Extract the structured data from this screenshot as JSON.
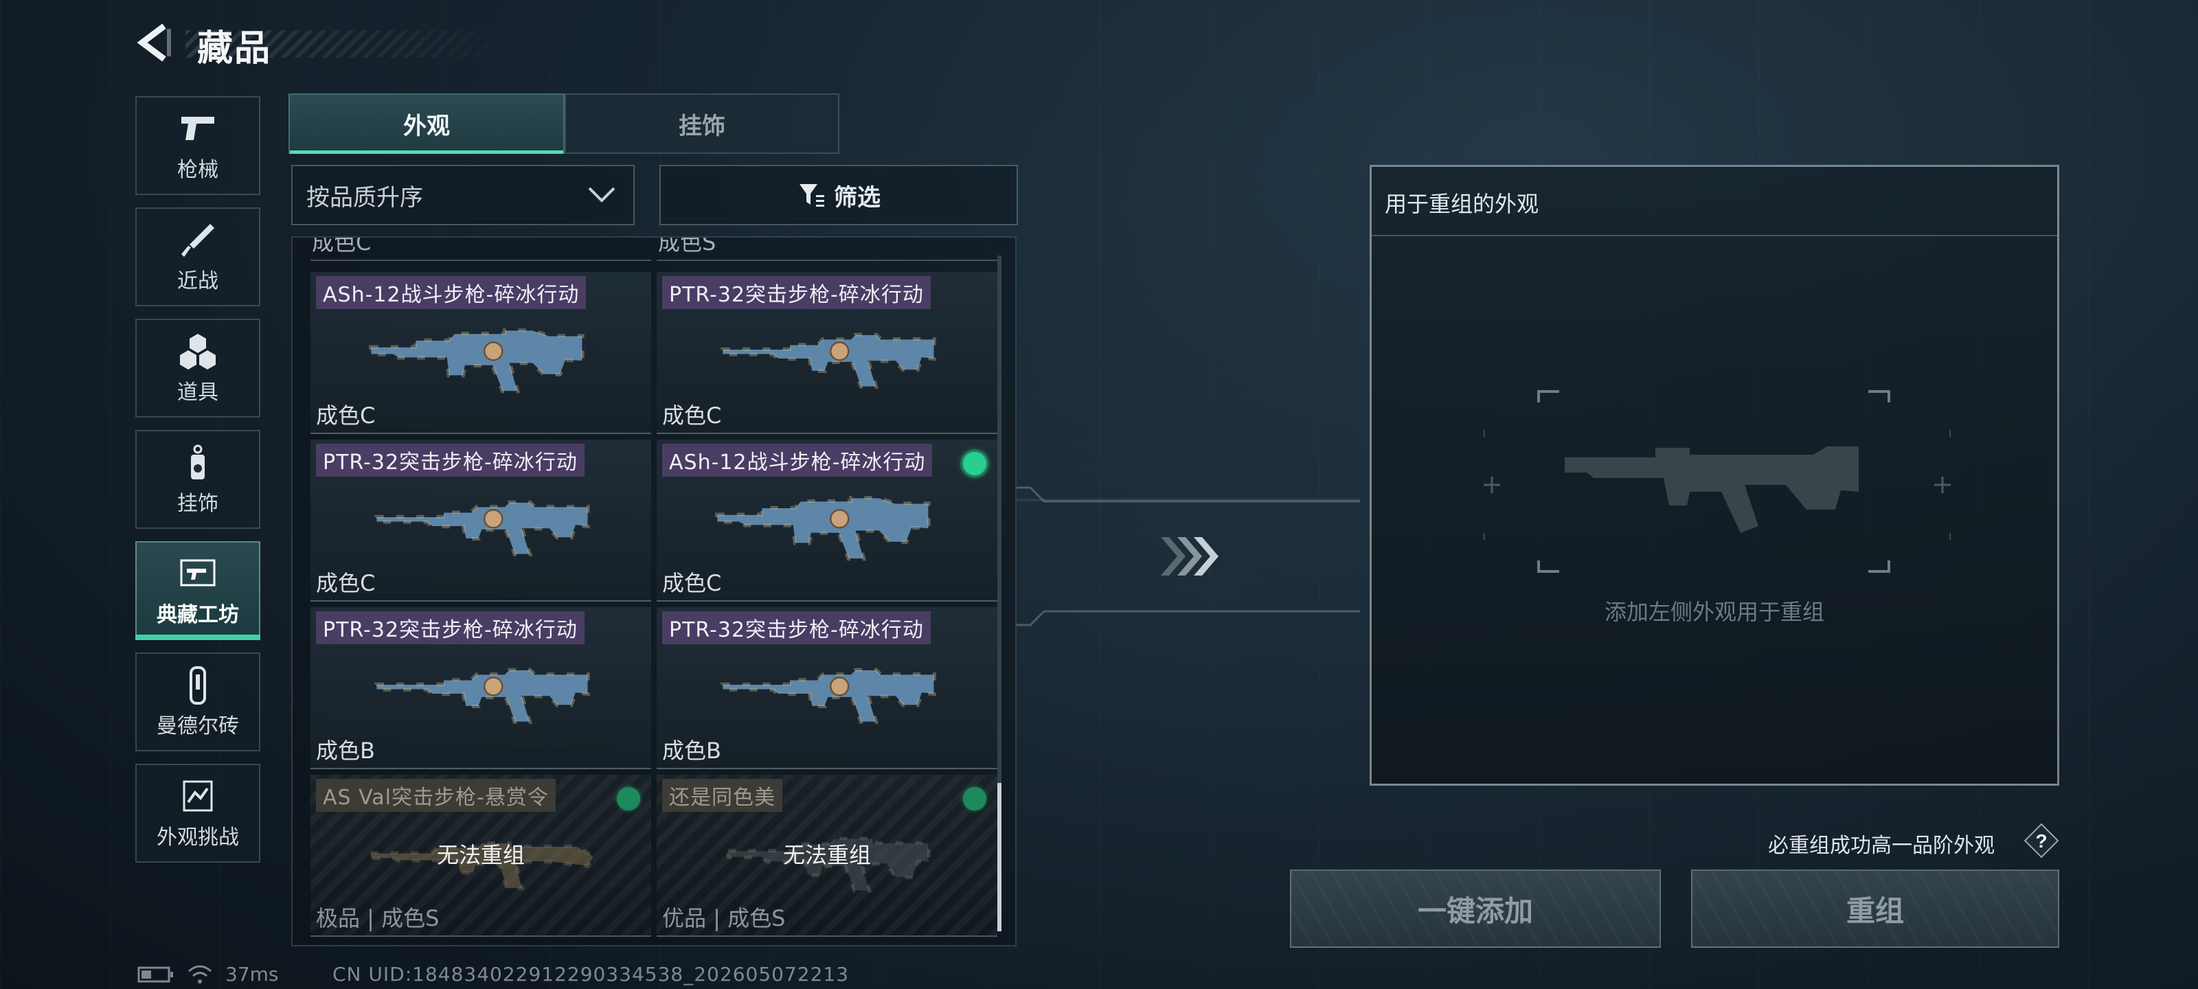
{
  "header": {
    "title": "藏品",
    "back_icon": "back-arrow-icon"
  },
  "sidebar": {
    "items": [
      {
        "label": "枪械",
        "icon": "pistol-icon"
      },
      {
        "label": "近战",
        "icon": "knife-icon"
      },
      {
        "label": "道具",
        "icon": "cubes-icon"
      },
      {
        "label": "挂饰",
        "icon": "charm-icon"
      },
      {
        "label": "典藏工坊",
        "icon": "workshop-icon",
        "active": true
      },
      {
        "label": "曼德尔砖",
        "icon": "brick-icon"
      },
      {
        "label": "外观挑战",
        "icon": "challenge-icon"
      }
    ]
  },
  "tabs": [
    {
      "label": "外观",
      "active": true
    },
    {
      "label": "挂饰",
      "active": false
    }
  ],
  "sort": {
    "value": "按品质升序"
  },
  "filter": {
    "label": "筛选"
  },
  "grid": {
    "peek_left": "成色C",
    "peek_right": "成色S",
    "cards": [
      {
        "name": "ASh-12战斗步枪-碎冰行动",
        "quality": "成色C"
      },
      {
        "name": "PTR-32突击步枪-碎冰行动",
        "quality": "成色C"
      },
      {
        "name": "PTR-32突击步枪-碎冰行动",
        "quality": "成色C"
      },
      {
        "name": "ASh-12战斗步枪-碎冰行动",
        "quality": "成色C"
      },
      {
        "name": "PTR-32突击步枪-碎冰行动",
        "quality": "成色B"
      },
      {
        "name": "PTR-32突击步枪-碎冰行动",
        "quality": "成色B"
      },
      {
        "name": "AS Val突击步枪-悬赏令",
        "quality": "极品 | 成色S",
        "status": "无法重组"
      },
      {
        "name": "还是同色美",
        "quality": "优品 | 成色S",
        "status": "无法重组"
      }
    ]
  },
  "panel": {
    "title": "用于重组的外观",
    "hint": "添加左侧外观用于重组"
  },
  "note": "必重组成功高一品阶外观",
  "help_label": "?",
  "buttons": {
    "add_all": "一键添加",
    "recombine": "重组"
  },
  "status": {
    "ping": "37ms",
    "uid": "CN UID:18483402291229033453​8_202605072213"
  },
  "colors": {
    "accent": "#4fe0b5",
    "equipped_dot": "#27d08c",
    "name_tag": "#4a3d63"
  }
}
